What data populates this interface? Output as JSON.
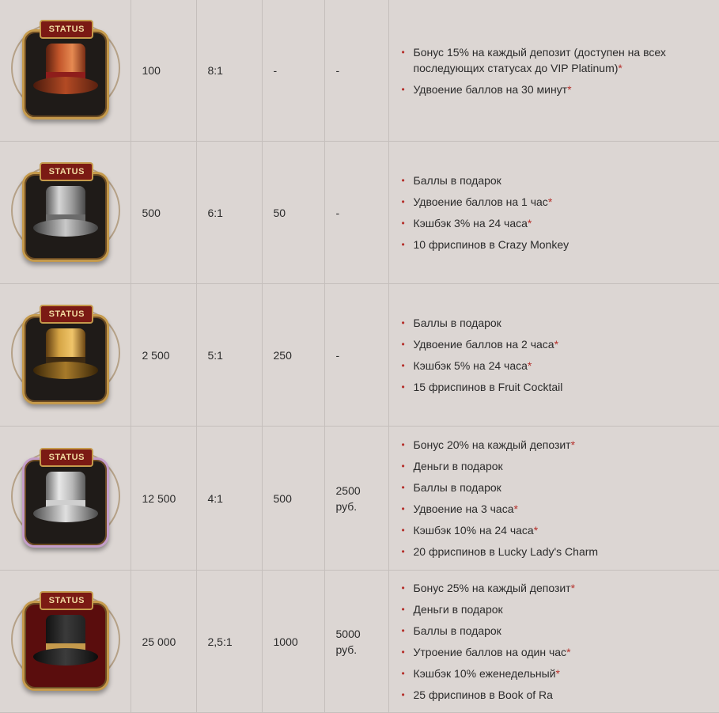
{
  "badge_label": "STATUS",
  "rows": [
    {
      "icon": "copper-top-hat-status-badge",
      "points": "100",
      "ratio": "8:1",
      "bonus": "-",
      "cash": [
        "-"
      ],
      "perks": [
        {
          "text": "Бонус 15% на каждый депозит (доступен на всех последующих статусах до VIP Platinum)",
          "star": "*"
        },
        {
          "text": "Удвоение баллов на 30 минут",
          "star": "*"
        }
      ]
    },
    {
      "icon": "silver-top-hat-status-badge",
      "points": "500",
      "ratio": "6:1",
      "bonus": "50",
      "cash": [
        "-"
      ],
      "perks": [
        {
          "text": "Баллы в подарок",
          "star": ""
        },
        {
          "text": "Удвоение баллов на 1 час",
          "star": "*"
        },
        {
          "text": "Кэшбэк 3% на 24 часа",
          "star": "*"
        },
        {
          "text": "10 фриспинов в Crazy Monkey",
          "star": ""
        }
      ]
    },
    {
      "icon": "gold-top-hat-status-badge",
      "points": "2 500",
      "ratio": "5:1",
      "bonus": "250",
      "cash": [
        "-"
      ],
      "perks": [
        {
          "text": "Баллы в подарок",
          "star": ""
        },
        {
          "text": "Удвоение баллов на 2 часа",
          "star": "*"
        },
        {
          "text": "Кэшбэк 5% на 24 часа",
          "star": "*"
        },
        {
          "text": "15 фриспинов в Fruit Cocktail",
          "star": ""
        }
      ]
    },
    {
      "icon": "platinum-top-hat-status-badge",
      "points": "12 500",
      "ratio": "4:1",
      "bonus": "500",
      "cash": [
        "2500",
        "руб."
      ],
      "perks": [
        {
          "text": "Бонус 20% на каждый депозит",
          "star": "*"
        },
        {
          "text": "Деньги в подарок",
          "star": ""
        },
        {
          "text": "Баллы в подарок",
          "star": ""
        },
        {
          "text": "Удвоение на 3 часа",
          "star": "*"
        },
        {
          "text": "Кэшбэк 10% на 24 часа",
          "star": "*"
        },
        {
          "text": "20 фриспинов в Lucky Lady's Charm",
          "star": ""
        }
      ]
    },
    {
      "icon": "vip-black-top-hat-status-badge",
      "points": "25 000",
      "ratio": "2,5:1",
      "bonus": "1000",
      "cash": [
        "5000",
        "руб."
      ],
      "perks": [
        {
          "text": "Бонус 25% на каждый депозит",
          "star": "*"
        },
        {
          "text": "Деньги в подарок",
          "star": ""
        },
        {
          "text": "Баллы в подарок",
          "star": ""
        },
        {
          "text": "Утроение баллов на один час",
          "star": "*"
        },
        {
          "text": "Кэшбэк 10% еженедельный",
          "star": "*"
        },
        {
          "text": "25 фриспинов в Book of Ra",
          "star": ""
        }
      ]
    }
  ],
  "colors": {
    "background": "#dcd6d3",
    "border": "#c5bfbc",
    "accent": "#b5302b",
    "text": "#2b2b2b"
  }
}
